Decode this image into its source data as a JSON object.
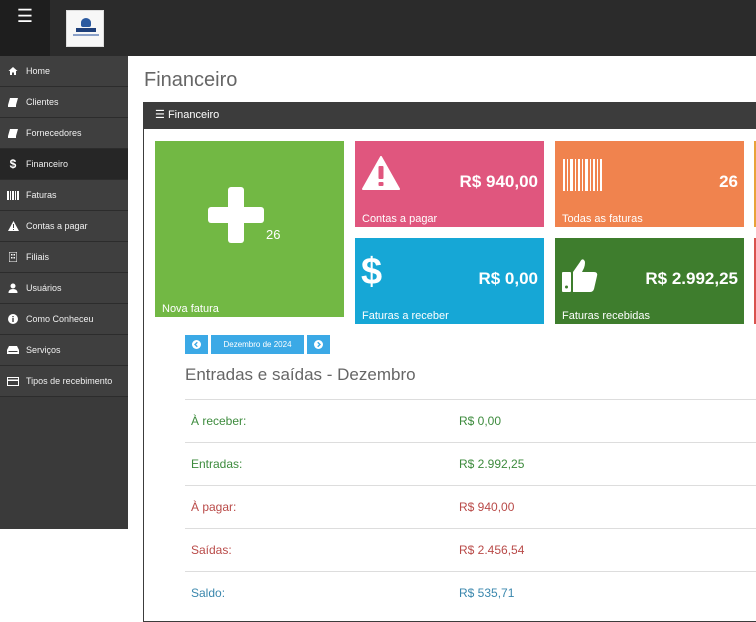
{
  "sidebar": {
    "items": [
      {
        "label": "Home",
        "icon": "home-icon"
      },
      {
        "label": "Clientes",
        "icon": "book-icon"
      },
      {
        "label": "Fornecedores",
        "icon": "book-icon"
      },
      {
        "label": "Financeiro",
        "icon": "dollar-icon"
      },
      {
        "label": "Faturas",
        "icon": "barcode-icon"
      },
      {
        "label": "Contas a pagar",
        "icon": "warning-icon"
      },
      {
        "label": "Filiais",
        "icon": "building-icon"
      },
      {
        "label": "Usuários",
        "icon": "user-icon"
      },
      {
        "label": "Como Conheceu",
        "icon": "info-icon"
      },
      {
        "label": "Serviços",
        "icon": "hdd-icon"
      },
      {
        "label": "Tipos de recebimento",
        "icon": "credit-card-icon"
      }
    ],
    "active": "Financeiro"
  },
  "page": {
    "title": "Financeiro"
  },
  "panel": {
    "heading": "Financeiro"
  },
  "tiles": {
    "nova_fatura": {
      "count": "26",
      "caption": "Nova fatura",
      "color": "#72b844"
    },
    "contas_a_pagar": {
      "value": "R$ 940,00",
      "caption": "Contas a pagar",
      "color": "#e0567e"
    },
    "todas_faturas": {
      "value": "26",
      "caption": "Todas as faturas",
      "color": "#f0834e"
    },
    "faturas_a_receber": {
      "value": "R$ 0,00",
      "caption": "Faturas a receber",
      "color": "#16a7d6"
    },
    "faturas_recebidas": {
      "value": "R$ 2.992,25",
      "caption": "Faturas recebidas",
      "color": "#3e7d2d"
    }
  },
  "month_nav": {
    "current": "Dezembro de 2024"
  },
  "summary": {
    "title": "Entradas e saídas - Dezembro",
    "rows": [
      {
        "label": "À receber:",
        "value": "R$ 0,00",
        "tone": "green"
      },
      {
        "label": "Entradas:",
        "value": "R$ 2.992,25",
        "tone": "green"
      },
      {
        "label": "À pagar:",
        "value": "R$ 940,00",
        "tone": "red"
      },
      {
        "label": "Saídas:",
        "value": "R$ 2.456,54",
        "tone": "red"
      },
      {
        "label": "Saldo:",
        "value": "R$ 535,71",
        "tone": "blue"
      }
    ]
  }
}
